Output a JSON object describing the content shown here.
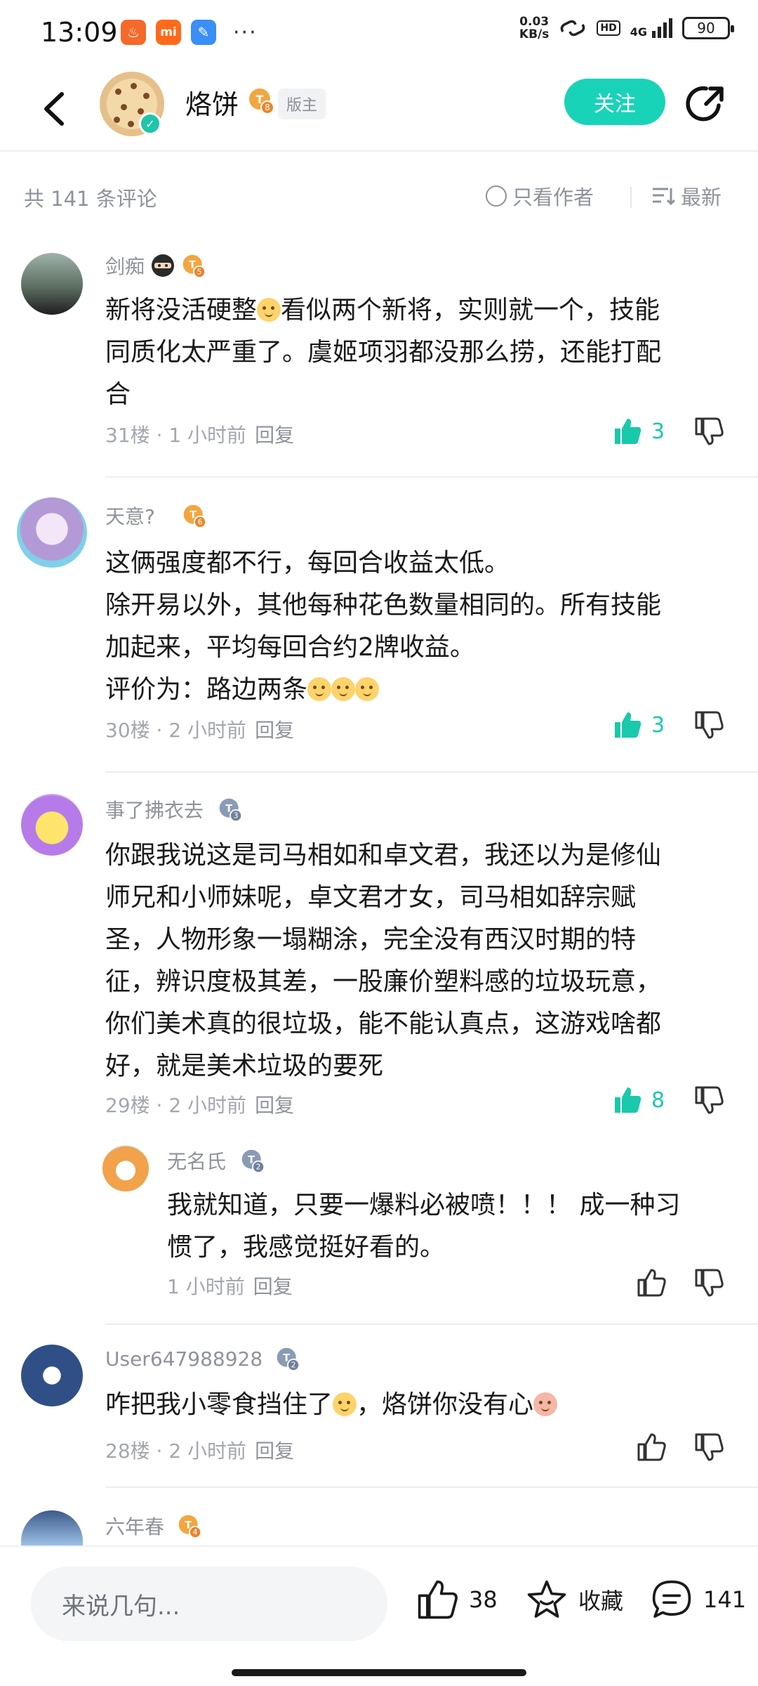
{
  "status_bar": {
    "time": "13:09",
    "apps": [
      "app-1",
      "mi",
      "app-3"
    ],
    "dots": "···",
    "speed_value": "0.03",
    "speed_unit": "KB/s",
    "hd": "HD",
    "network": "4G",
    "battery": "90"
  },
  "header": {
    "name": "烙饼",
    "level": "8",
    "role": "版主",
    "follow_label": "关注"
  },
  "subbar": {
    "count_label": "共 141 条评论",
    "author_only_label": "只看作者",
    "sort_label": "最新"
  },
  "comments": [
    {
      "user": "剑痴",
      "level": "5",
      "lines": [
        "新将没活硬整",
        "看似两个新将，实则就一个，技能",
        "同质化太严重了。虞姬项羽都没那么捞，还能打配",
        "合"
      ],
      "floor": "31楼",
      "time": "1 小时前",
      "reply": "回复",
      "likes": "3"
    },
    {
      "user": "天意?",
      "level": "6",
      "lines": [
        "这俩强度都不行，每回合收益太低。",
        "除开易以外，其他每种花色数量相同的。所有技能",
        "加起来，平均每回合约2牌收益。",
        "评价为：路边两条"
      ],
      "floor": "30楼",
      "time": "2 小时前",
      "reply": "回复",
      "likes": "3"
    },
    {
      "user": "事了拂衣去",
      "level": "3",
      "lines": [
        "你跟我说这是司马相如和卓文君，我还以为是修仙",
        "师兄和小师妹呢，卓文君才女，司马相如辞宗赋",
        "圣，人物形象一塌糊涂，完全没有西汉时期的特",
        "征，辨识度极其差，一股廉价塑料感的垃圾玩意，",
        "你们美术真的很垃圾，能不能认真点，这游戏啥都",
        "好，就是美术垃圾的要死"
      ],
      "floor": "29楼",
      "time": "2 小时前",
      "reply": "回复",
      "likes": "8"
    },
    {
      "user": "无名氏",
      "level": "2",
      "lines": [
        "我就知道，只要一爆料必被喷！！！ 成一种习",
        "惯了，我感觉挺好看的。"
      ],
      "time": "1 小时前",
      "reply": "回复"
    },
    {
      "user": "User647988928",
      "level": "2",
      "lines": [
        "咋把我小零食挡住了",
        "，烙饼你没有心"
      ],
      "floor": "28楼",
      "time": "2 小时前",
      "reply": "回复"
    },
    {
      "user": "六年春",
      "level": "4"
    }
  ],
  "bottom_bar": {
    "input_placeholder": "来说几句...",
    "like_count": "38",
    "favorite_label": "收藏",
    "comment_count": "141"
  },
  "colors": {
    "accent": "#19d3b9",
    "like_active": "#19c9ab",
    "muted_text": "#8e939b"
  }
}
